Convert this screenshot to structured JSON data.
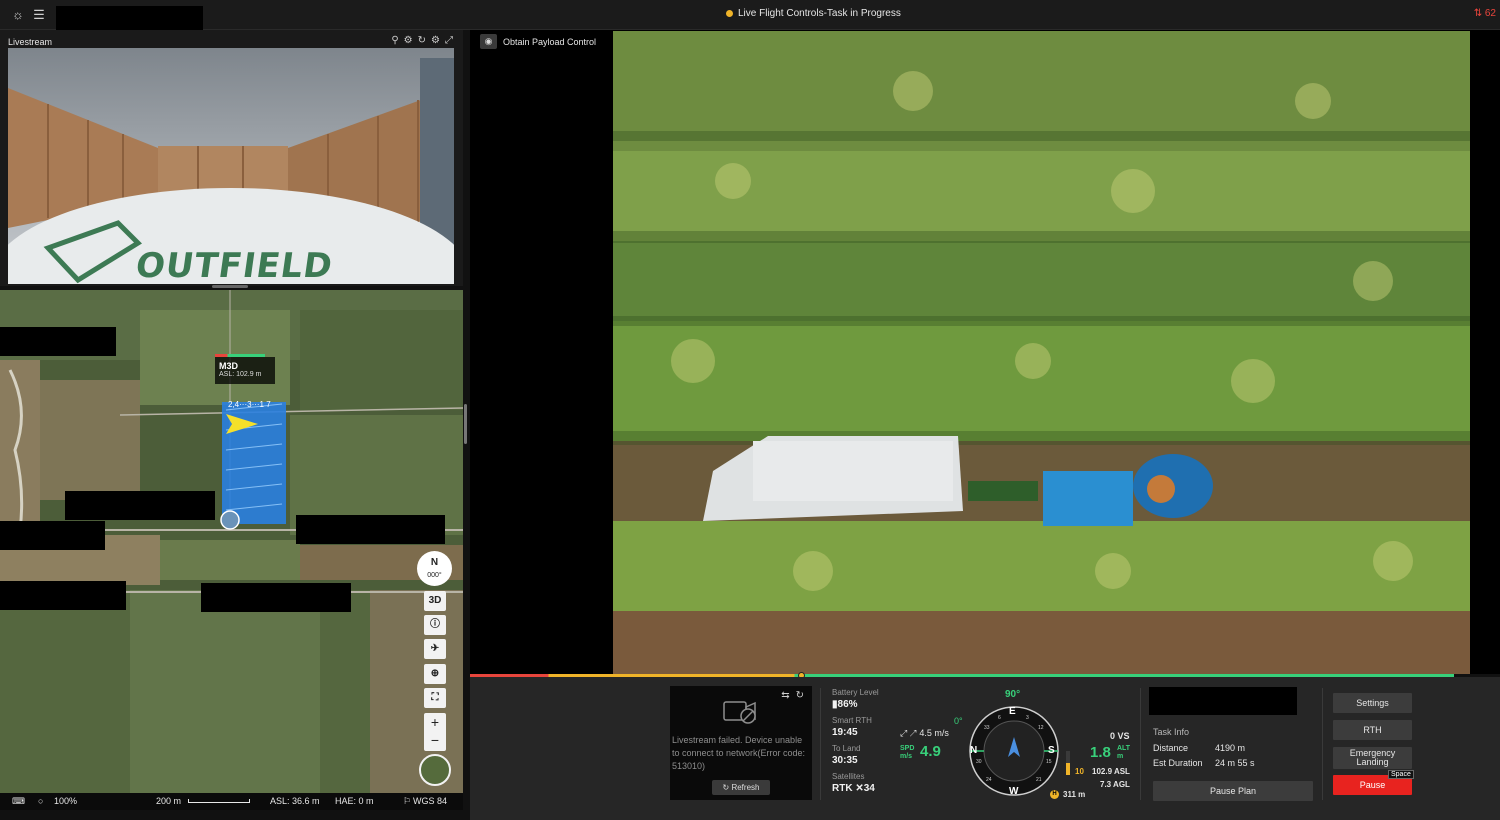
{
  "topbar": {
    "status_title": "Live Flight Controls-Task in Progress",
    "signal_value": "62"
  },
  "livestream": {
    "header": "Livestream",
    "sign_text": "OUTFIELD"
  },
  "payload": {
    "obtain_label": "Obtain Payload Control"
  },
  "map": {
    "drone_name": "M3D",
    "drone_asl": "ASL: 102.9 m",
    "waypoints": "2,4···3···1 7",
    "compass_n": "N",
    "compass_deg": "000°",
    "btn_3d": "3D",
    "zoom_in": "+",
    "zoom_out": "−"
  },
  "statusbar": {
    "zoom": "100%",
    "scale": "200 m",
    "asl": "ASL: 36.6 m",
    "hae": "HAE: 0 m",
    "datum": "WGS 84"
  },
  "livestream_fail": {
    "message": "Livestream failed. Device unable to connect to network(Error code: 513010)",
    "refresh": "Refresh"
  },
  "stats": {
    "battery_label": "Battery Level",
    "battery_value": "86%",
    "smart_rth_label": "Smart RTH",
    "smart_rth_value": "19:45",
    "to_land_label": "To Land",
    "to_land_value": "30:35",
    "satellites_label": "Satellites",
    "satellites_value": "RTK ✕34"
  },
  "flight": {
    "wind": "4.5 m/s",
    "speed": "4.9",
    "speed_label": "SPD m/s",
    "attitude": "0°",
    "heading": "90°",
    "vs": "0 VS",
    "alt": "1.8",
    "alt_label": "ALT m",
    "alt_marker": "10",
    "asl": "102.9 ASL",
    "agl": "7.3 AGL",
    "home_distance": "311 m",
    "compass_e": "E",
    "compass_s": "S",
    "compass_w": "W",
    "compass_n": "N"
  },
  "task_info": {
    "title": "Task Info",
    "distance_label": "Distance",
    "distance_value": "4190 m",
    "duration_label": "Est Duration",
    "duration_value": "24 m 55 s"
  },
  "buttons": {
    "pause_plan": "Pause Plan",
    "settings": "Settings",
    "rth": "RTH",
    "emergency_landing": "Emergency Landing",
    "pause": "Pause",
    "space_hint": "Space"
  },
  "colors": {
    "accent_green": "#38d07a",
    "warning_orange": "#f0b429",
    "danger_red": "#e8231f"
  }
}
